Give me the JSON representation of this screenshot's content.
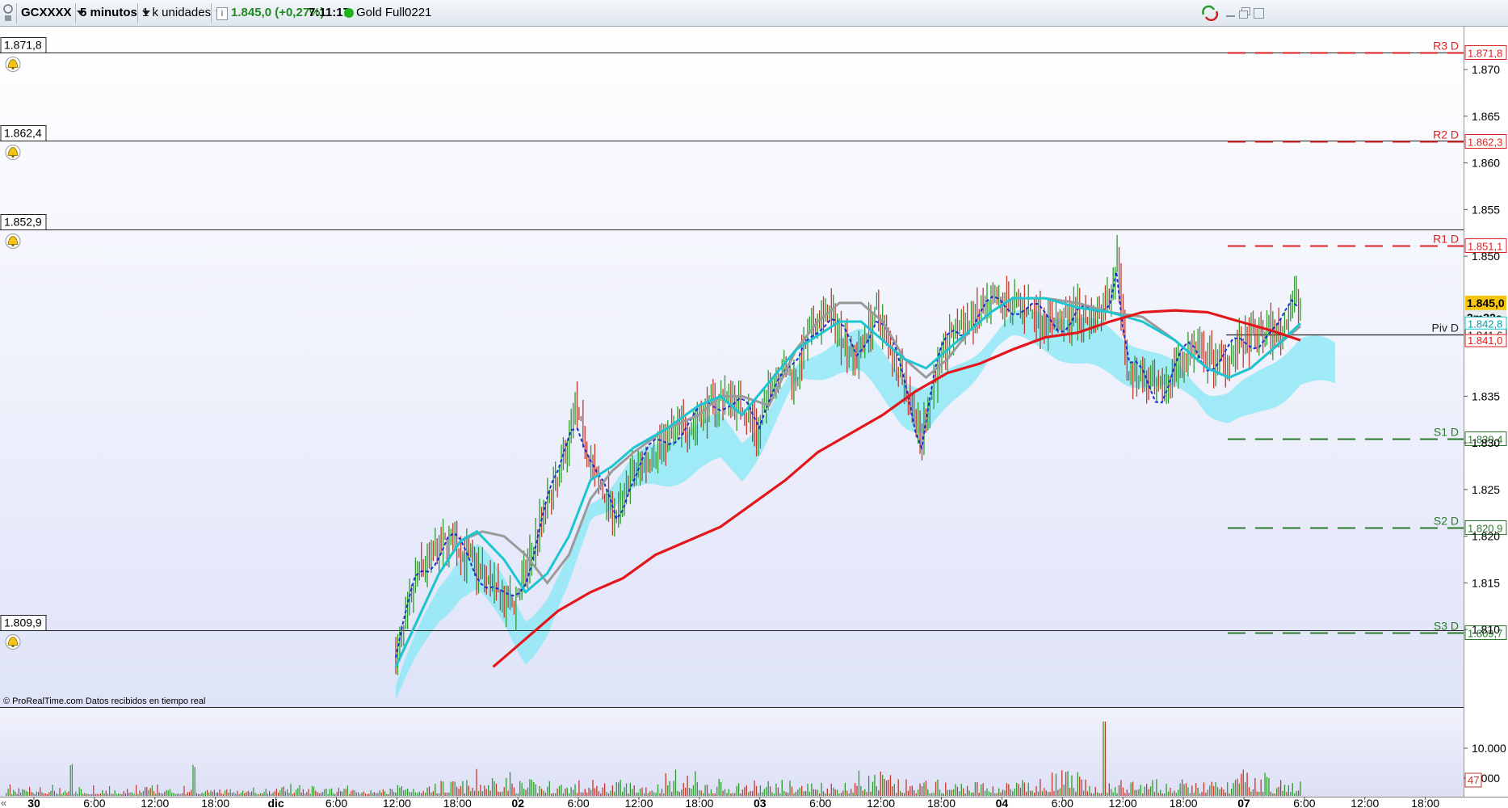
{
  "toolbar": {
    "symbol": "GCXXXX",
    "timeframe": "5 minutos",
    "units": "1 k unidades",
    "info_icon": "info-icon",
    "last_price": "1.845,0 (+0,27%)",
    "clock": "7:11:17",
    "instrument": "Gold Full0221"
  },
  "source_note": "© ProRealTime.com  Datos recibidos en tiempo real",
  "colors": {
    "accent_up": "#2a8c2a",
    "resistance": "#dd2222",
    "support": "#2a7a2a",
    "cloud": "#86e8f5",
    "ma_red": "#e3171b",
    "ma_cyan": "#1cc6d0",
    "ma_gray": "#9a9a9a",
    "dotted_blue": "#1a2fd6"
  },
  "alert_levels": [
    "1.871,8",
    "1.862,4",
    "1.852,9",
    "1.809,9"
  ],
  "pivots": [
    {
      "label": "R3 D",
      "value": "1.871,8",
      "y": 1871.8,
      "kind": "resistance"
    },
    {
      "label": "R2 D",
      "value": "1.862,3",
      "y": 1862.3,
      "kind": "resistance"
    },
    {
      "label": "R1 D",
      "value": "1.851,1",
      "y": 1851.1,
      "kind": "resistance"
    },
    {
      "label": "Piv D",
      "value": "1.841,6",
      "y": 1841.6,
      "kind": "pivot"
    },
    {
      "label": "S1 D",
      "value": "1.830,4",
      "y": 1830.4,
      "kind": "support"
    },
    {
      "label": "S2 D",
      "value": "1.820,9",
      "y": 1820.9,
      "kind": "support"
    },
    {
      "label": "S3 D",
      "value": "1.809,7",
      "y": 1809.7,
      "kind": "support"
    }
  ],
  "price_axis": {
    "ticks": [
      "1.870",
      "1.865",
      "1.860",
      "1.855",
      "1.850",
      "1.835",
      "1.830",
      "1.825",
      "1.820",
      "1.815",
      "1.810"
    ],
    "current_price": "1.845,0",
    "countdown": "3m32s",
    "cyan_tag": "1.842,8",
    "red_tag": "1.841,0"
  },
  "volume_axis": {
    "ticks": [
      "10.000",
      "5.000"
    ],
    "current": "47"
  },
  "time_axis": {
    "labels": [
      "30",
      "6:00",
      "12:00",
      "18:00",
      "dic",
      "6:00",
      "12:00",
      "18:00",
      "02",
      "6:00",
      "12:00",
      "18:00",
      "03",
      "6:00",
      "12:00",
      "18:00",
      "04",
      "6:00",
      "12:00",
      "18:00",
      "07",
      "6:00",
      "12:00",
      "18:00"
    ],
    "bold": [
      "30",
      "dic",
      "02",
      "03",
      "04",
      "07"
    ]
  },
  "chart_data": {
    "type": "candlestick",
    "ylim": [
      1806,
      1876
    ],
    "price_path": [
      [
        0.0,
        1807
      ],
      [
        0.01,
        1811
      ],
      [
        0.02,
        1816
      ],
      [
        0.035,
        1818
      ],
      [
        0.05,
        1819.5
      ],
      [
        0.065,
        1818
      ],
      [
        0.08,
        1816
      ],
      [
        0.09,
        1814.5
      ],
      [
        0.1,
        1812.5
      ],
      [
        0.11,
        1813
      ],
      [
        0.12,
        1816
      ],
      [
        0.135,
        1822
      ],
      [
        0.15,
        1826
      ],
      [
        0.16,
        1831
      ],
      [
        0.165,
        1834
      ],
      [
        0.175,
        1830
      ],
      [
        0.185,
        1826
      ],
      [
        0.195,
        1824
      ],
      [
        0.205,
        1822
      ],
      [
        0.215,
        1826
      ],
      [
        0.23,
        1828
      ],
      [
        0.245,
        1830
      ],
      [
        0.26,
        1831.5
      ],
      [
        0.275,
        1832
      ],
      [
        0.29,
        1834
      ],
      [
        0.305,
        1835
      ],
      [
        0.32,
        1834
      ],
      [
        0.335,
        1831
      ],
      [
        0.345,
        1836
      ],
      [
        0.355,
        1838
      ],
      [
        0.37,
        1837
      ],
      [
        0.38,
        1841
      ],
      [
        0.39,
        1843
      ],
      [
        0.4,
        1844
      ],
      [
        0.415,
        1841
      ],
      [
        0.425,
        1839
      ],
      [
        0.435,
        1842
      ],
      [
        0.445,
        1844
      ],
      [
        0.455,
        1841
      ],
      [
        0.465,
        1838
      ],
      [
        0.475,
        1835
      ],
      [
        0.485,
        1830
      ],
      [
        0.49,
        1833
      ],
      [
        0.5,
        1838
      ],
      [
        0.515,
        1842
      ],
      [
        0.53,
        1843
      ],
      [
        0.545,
        1844
      ],
      [
        0.56,
        1845
      ],
      [
        0.575,
        1845
      ],
      [
        0.59,
        1844
      ],
      [
        0.6,
        1843
      ],
      [
        0.615,
        1843
      ],
      [
        0.63,
        1844
      ],
      [
        0.645,
        1843
      ],
      [
        0.66,
        1846
      ],
      [
        0.667,
        1850
      ],
      [
        0.675,
        1838
      ],
      [
        0.69,
        1837
      ],
      [
        0.705,
        1835
      ],
      [
        0.72,
        1838
      ],
      [
        0.735,
        1840
      ],
      [
        0.75,
        1839
      ],
      [
        0.765,
        1839
      ],
      [
        0.775,
        1840
      ],
      [
        0.79,
        1841
      ],
      [
        0.805,
        1842
      ],
      [
        0.815,
        1841.5
      ],
      [
        0.822,
        1843
      ],
      [
        0.83,
        1845.5
      ],
      [
        0.836,
        1845
      ]
    ],
    "ma_red": [
      [
        0.09,
        1806
      ],
      [
        0.12,
        1809
      ],
      [
        0.15,
        1812
      ],
      [
        0.18,
        1814
      ],
      [
        0.21,
        1815.5
      ],
      [
        0.24,
        1818
      ],
      [
        0.27,
        1819.5
      ],
      [
        0.3,
        1821
      ],
      [
        0.33,
        1823.5
      ],
      [
        0.36,
        1826
      ],
      [
        0.39,
        1829
      ],
      [
        0.42,
        1831
      ],
      [
        0.45,
        1833
      ],
      [
        0.48,
        1835.5
      ],
      [
        0.51,
        1837.5
      ],
      [
        0.54,
        1838.5
      ],
      [
        0.57,
        1840
      ],
      [
        0.6,
        1841.3
      ],
      [
        0.63,
        1841.8
      ],
      [
        0.66,
        1843
      ],
      [
        0.69,
        1844
      ],
      [
        0.72,
        1844.2
      ],
      [
        0.75,
        1844
      ],
      [
        0.78,
        1843
      ],
      [
        0.81,
        1842
      ],
      [
        0.836,
        1841
      ]
    ],
    "ma_cyan": [
      [
        0.0,
        1806
      ],
      [
        0.02,
        1811
      ],
      [
        0.04,
        1816
      ],
      [
        0.06,
        1819.5
      ],
      [
        0.075,
        1820.5
      ],
      [
        0.1,
        1817.5
      ],
      [
        0.12,
        1814
      ],
      [
        0.14,
        1816
      ],
      [
        0.16,
        1820
      ],
      [
        0.18,
        1826
      ],
      [
        0.2,
        1827.5
      ],
      [
        0.22,
        1829.5
      ],
      [
        0.25,
        1831.5
      ],
      [
        0.28,
        1834
      ],
      [
        0.3,
        1835
      ],
      [
        0.32,
        1833
      ],
      [
        0.345,
        1836.5
      ],
      [
        0.37,
        1840
      ],
      [
        0.39,
        1841.5
      ],
      [
        0.41,
        1843
      ],
      [
        0.43,
        1843
      ],
      [
        0.45,
        1841
      ],
      [
        0.47,
        1839
      ],
      [
        0.49,
        1838
      ],
      [
        0.51,
        1840
      ],
      [
        0.53,
        1842
      ],
      [
        0.55,
        1844
      ],
      [
        0.57,
        1845.5
      ],
      [
        0.6,
        1845.5
      ],
      [
        0.63,
        1844.5
      ],
      [
        0.66,
        1844
      ],
      [
        0.69,
        1843
      ],
      [
        0.72,
        1841
      ],
      [
        0.75,
        1838
      ],
      [
        0.77,
        1837
      ],
      [
        0.79,
        1838
      ],
      [
        0.81,
        1840
      ],
      [
        0.836,
        1842.8
      ]
    ],
    "ma_gray": [
      [
        0.0,
        1806
      ],
      [
        0.02,
        1811
      ],
      [
        0.04,
        1816
      ],
      [
        0.06,
        1819.5
      ],
      [
        0.08,
        1820.5
      ],
      [
        0.1,
        1820
      ],
      [
        0.12,
        1818
      ],
      [
        0.14,
        1815
      ],
      [
        0.16,
        1818
      ],
      [
        0.18,
        1824
      ],
      [
        0.2,
        1827
      ],
      [
        0.22,
        1829
      ],
      [
        0.25,
        1831.5
      ],
      [
        0.28,
        1833
      ],
      [
        0.3,
        1835
      ],
      [
        0.32,
        1835
      ],
      [
        0.345,
        1834
      ],
      [
        0.37,
        1840
      ],
      [
        0.39,
        1843
      ],
      [
        0.41,
        1845
      ],
      [
        0.43,
        1845
      ],
      [
        0.45,
        1843
      ],
      [
        0.47,
        1839
      ],
      [
        0.49,
        1837
      ],
      [
        0.51,
        1839
      ],
      [
        0.53,
        1842
      ],
      [
        0.55,
        1844
      ],
      [
        0.57,
        1845.5
      ],
      [
        0.6,
        1845.5
      ],
      [
        0.63,
        1845
      ],
      [
        0.66,
        1844
      ],
      [
        0.69,
        1843.5
      ],
      [
        0.72,
        1841
      ],
      [
        0.75,
        1838
      ],
      [
        0.77,
        1837
      ],
      [
        0.79,
        1838
      ],
      [
        0.81,
        1840
      ],
      [
        0.836,
        1842.5
      ]
    ]
  }
}
